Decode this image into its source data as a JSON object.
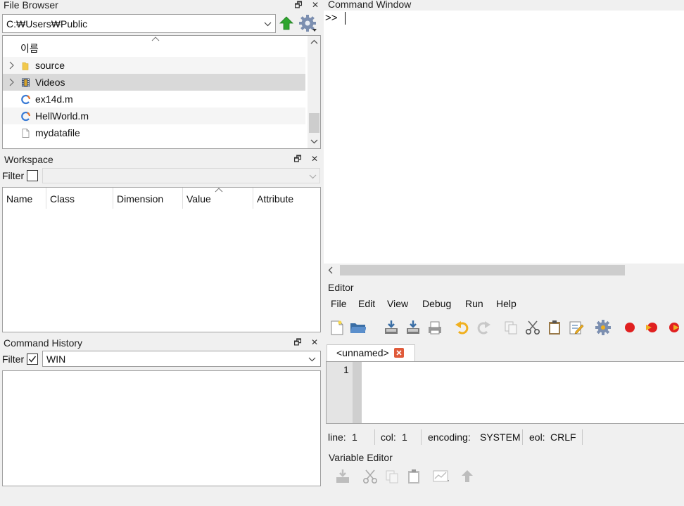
{
  "file_browser": {
    "title": "File Browser",
    "path": "C:₩Users₩Public",
    "column_name": "이름",
    "items": [
      {
        "label": "source",
        "type": "folder",
        "expandable": true
      },
      {
        "label": "Videos",
        "type": "video-folder",
        "expandable": true
      },
      {
        "label": "ex14d.m",
        "type": "m-file",
        "expandable": false
      },
      {
        "label": "HellWorld.m",
        "type": "m-file",
        "expandable": false
      },
      {
        "label": "mydatafile",
        "type": "file",
        "expandable": false
      }
    ]
  },
  "workspace": {
    "title": "Workspace",
    "filter_label": "Filter",
    "filter_checked": false,
    "filter_value": "",
    "columns": [
      "Name",
      "Class",
      "Dimension",
      "Value",
      "Attribute"
    ]
  },
  "command_history": {
    "title": "Command History",
    "filter_label": "Filter",
    "filter_checked": true,
    "filter_value": "WIN"
  },
  "command_window": {
    "title": "Command Window",
    "prompt": ">>"
  },
  "editor": {
    "title": "Editor",
    "menu": [
      "File",
      "Edit",
      "View",
      "Debug",
      "Run",
      "Help"
    ],
    "tab_label": "<unnamed>",
    "line_number": "1",
    "status": {
      "line_label": "line:",
      "line_value": "1",
      "col_label": "col:",
      "col_value": "1",
      "encoding_label": "encoding:",
      "encoding_value": "SYSTEM",
      "eol_label": "eol:",
      "eol_value": "CRLF"
    }
  },
  "variable_editor": {
    "title": "Variable Editor"
  },
  "colors": {
    "selected_row": "#d9d9d9",
    "alt_row": "#f5f5f5",
    "accent_green": "#2fa52f",
    "debug_red": "#e02020",
    "tab_close": "#e05a3a"
  }
}
